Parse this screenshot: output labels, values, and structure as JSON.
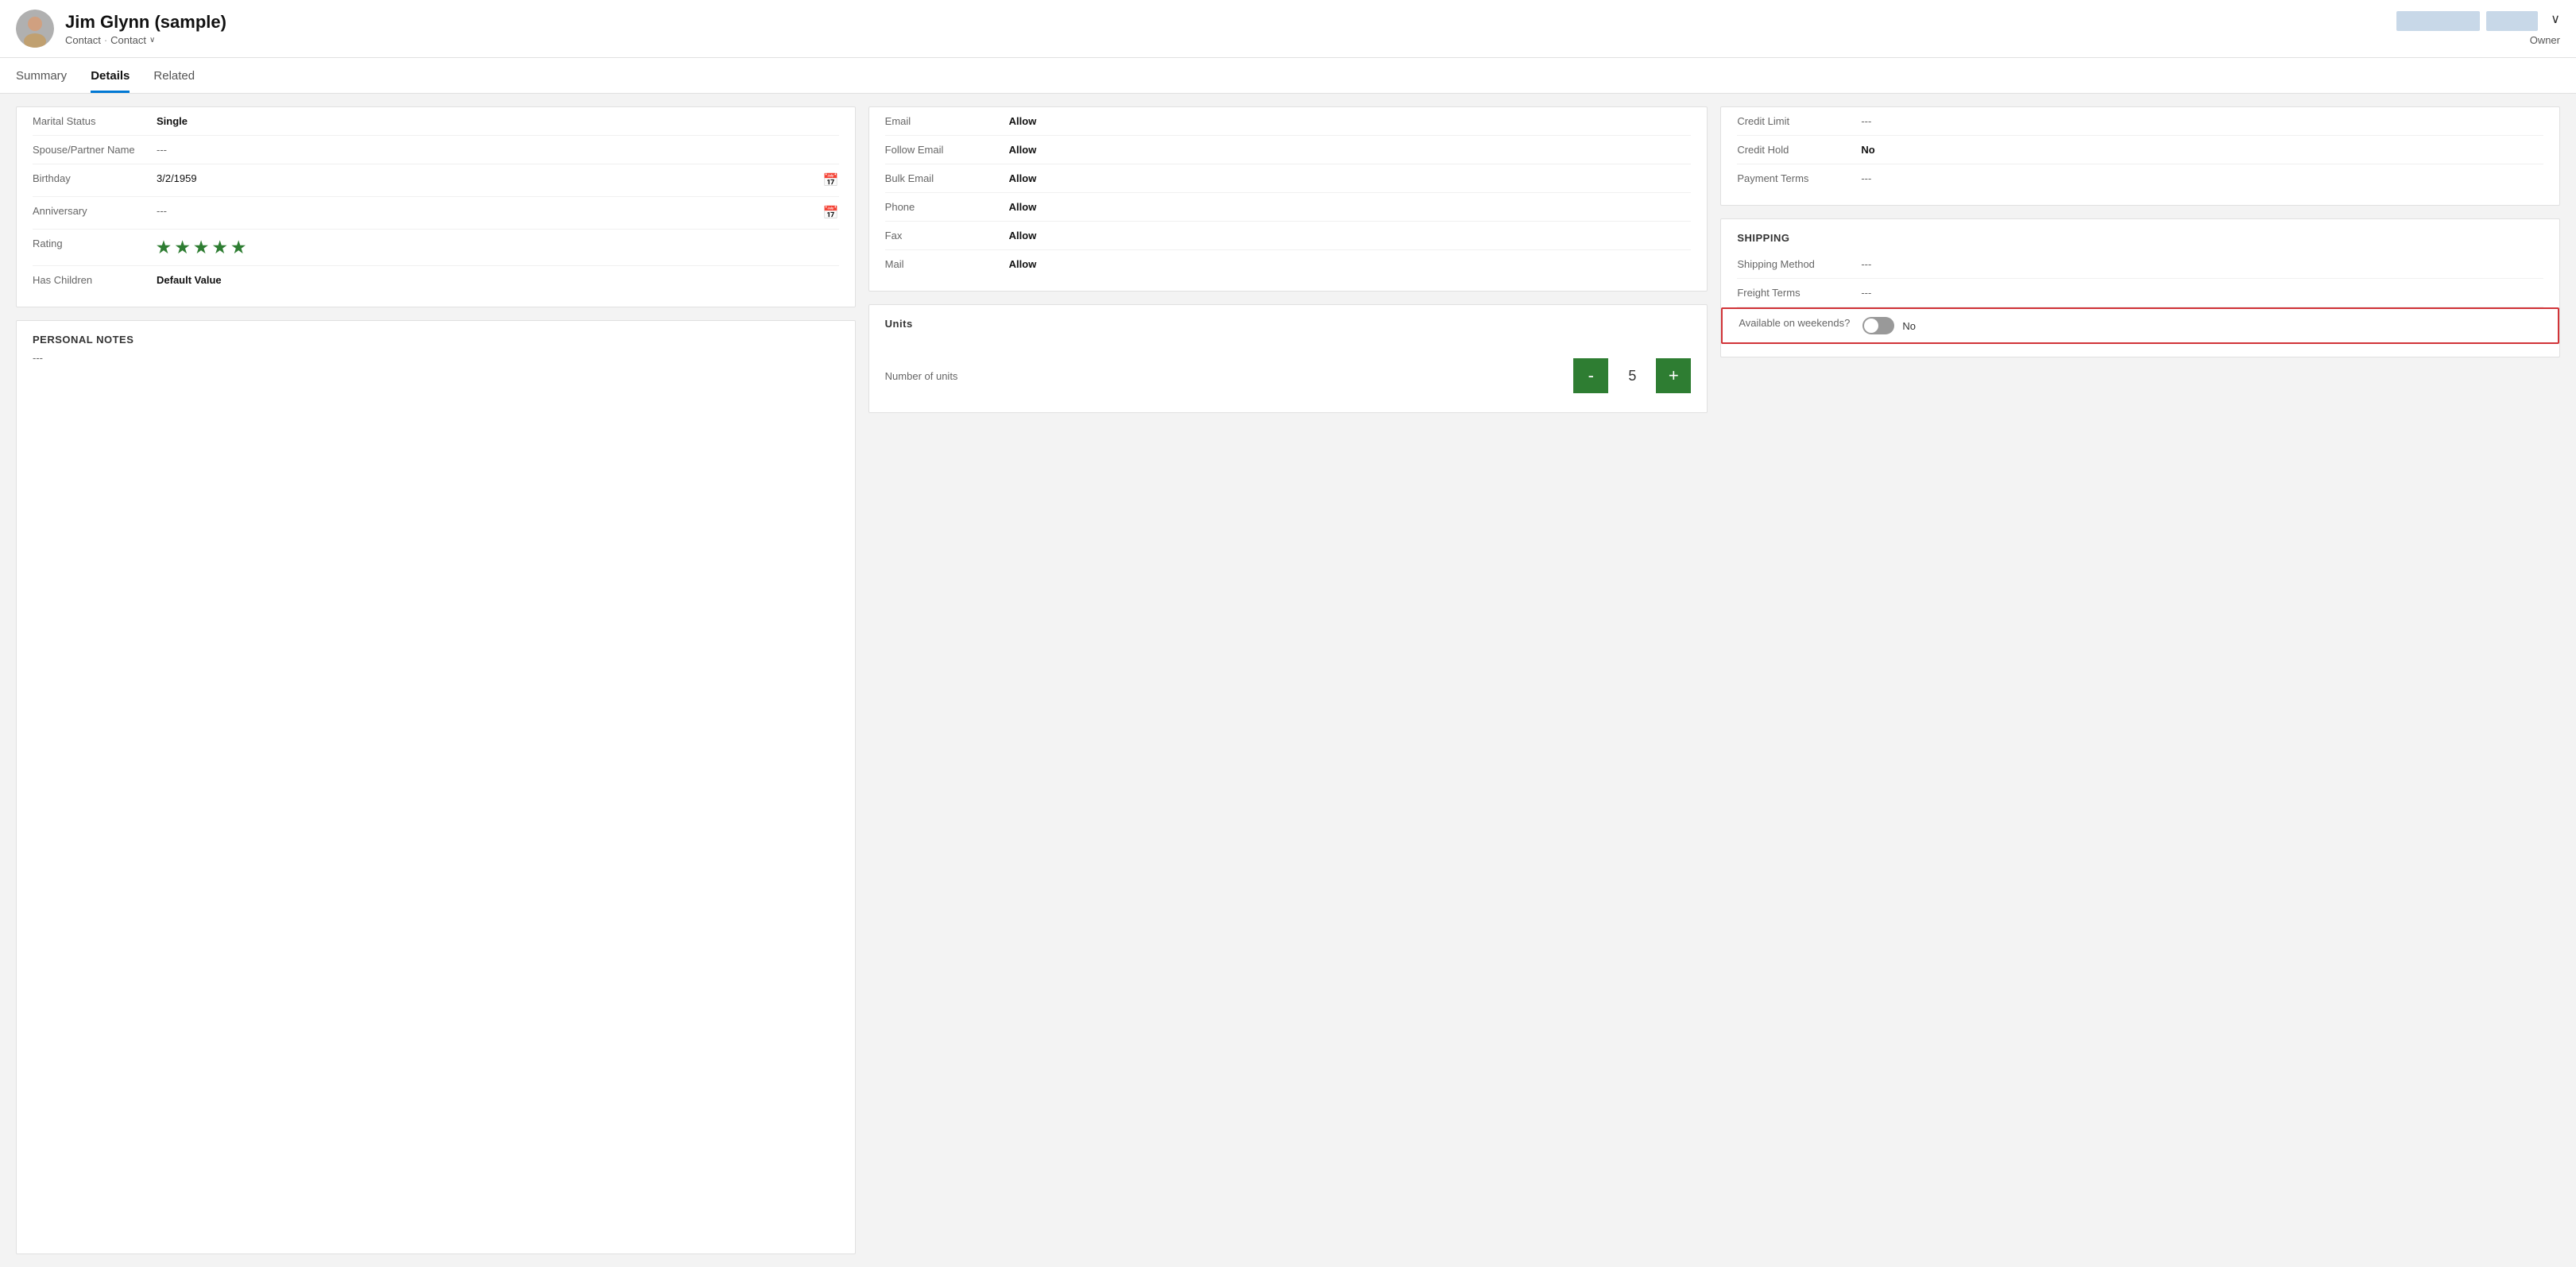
{
  "header": {
    "name": "Jim Glynn (sample)",
    "subtitle1": "Contact",
    "subtitle2": "Contact",
    "owner_label": "Owner",
    "chevron": "∨",
    "btn1": "████ ████",
    "btn2": "████"
  },
  "tabs": [
    {
      "label": "Summary",
      "active": false
    },
    {
      "label": "Details",
      "active": true
    },
    {
      "label": "Related",
      "active": false
    }
  ],
  "personal_info": {
    "section": "",
    "fields": [
      {
        "label": "Marital Status",
        "value": "Single",
        "bold": true
      },
      {
        "label": "Spouse/Partner Name",
        "value": "---",
        "bold": false
      },
      {
        "label": "Birthday",
        "value": "3/2/1959",
        "bold": false,
        "icon": "calendar"
      },
      {
        "label": "Anniversary",
        "value": "---",
        "bold": false,
        "icon": "calendar"
      },
      {
        "label": "Rating",
        "value": "★★★★★",
        "bold": false,
        "type": "stars"
      },
      {
        "label": "Has Children",
        "value": "Default Value",
        "bold": true
      }
    ]
  },
  "personal_notes": {
    "section": "PERSONAL NOTES",
    "value": "---"
  },
  "communication": {
    "fields": [
      {
        "label": "Email",
        "value": "Allow"
      },
      {
        "label": "Follow Email",
        "value": "Allow"
      },
      {
        "label": "Bulk Email",
        "value": "Allow"
      },
      {
        "label": "Phone",
        "value": "Allow"
      },
      {
        "label": "Fax",
        "value": "Allow"
      },
      {
        "label": "Mail",
        "value": "Allow"
      }
    ]
  },
  "units": {
    "section": "Units",
    "label": "Number of units",
    "minus": "-",
    "value": "5",
    "plus": "+"
  },
  "credit": {
    "fields": [
      {
        "label": "Credit Limit",
        "value": "---",
        "bold": false
      },
      {
        "label": "Credit Hold",
        "value": "No",
        "bold": true
      },
      {
        "label": "Payment Terms",
        "value": "---",
        "bold": false
      }
    ]
  },
  "shipping": {
    "section": "SHIPPING",
    "fields": [
      {
        "label": "Shipping Method",
        "value": "---",
        "bold": false
      },
      {
        "label": "Freight Terms",
        "value": "---",
        "bold": false
      }
    ],
    "weekend_label": "Available on weekends?",
    "weekend_value": "No",
    "toggle_state": false
  }
}
